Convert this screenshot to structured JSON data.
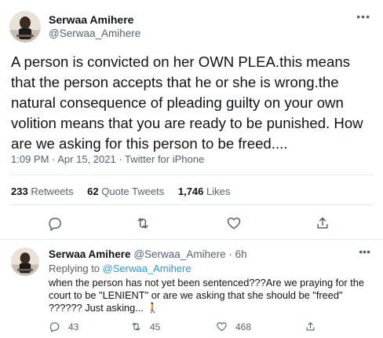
{
  "tweet": {
    "author_name": "Serwaa Amihere",
    "author_handle": "@Serwaa_Amihere",
    "text": "A person is convicted on her OWN PLEA.this means that the person accepts that he or she is wrong.the natural consequence of pleading guilty on your own volition means that you are ready to be punished. How are we asking for this  person to be freed....",
    "time": "1:09 PM",
    "date": "Apr 15, 2021",
    "source": "Twitter for iPhone",
    "separator": " · ",
    "stats": {
      "retweets_count": "233",
      "retweets_label": "Retweets",
      "quotes_count": "62",
      "quotes_label": "Quote Tweets",
      "likes_count": "1,746",
      "likes_label": "Likes"
    }
  },
  "reply": {
    "author_name": "Serwaa Amihere",
    "author_handle": "@Serwaa_Amihere",
    "age": "6h",
    "replying_prefix": "Replying to",
    "replying_to": "@Serwaa_Amihere",
    "text": "when the person has not yet been sentenced???Are we praying for the court to be \"LENIENT\" or are we asking that she should be \"freed\" ?????? Just asking... 🚶",
    "reply_count": "43",
    "retweet_count": "45",
    "like_count": "468"
  },
  "icons": {
    "more": "more-horizontal-icon",
    "reply": "comment-icon",
    "retweet": "retweet-icon",
    "like": "heart-icon",
    "share": "share-icon"
  },
  "colors": {
    "text": "#0f1419",
    "secondary": "#536471",
    "link": "#1d9bf0",
    "divider": "#e6ecf0"
  }
}
